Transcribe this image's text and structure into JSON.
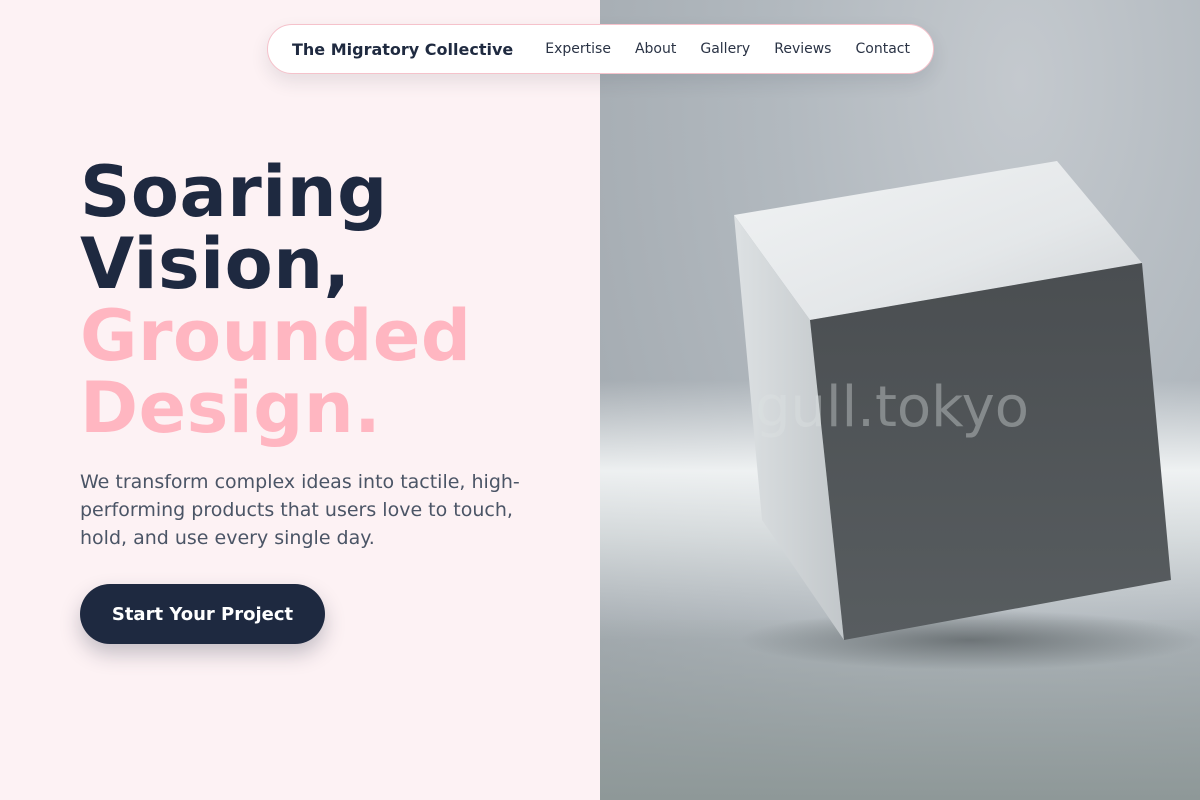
{
  "nav": {
    "brand": "The Migratory Collective",
    "links": [
      "Expertise",
      "About",
      "Gallery",
      "Reviews",
      "Contact"
    ]
  },
  "hero": {
    "headline_dark": [
      "Soaring",
      "Vision,"
    ],
    "headline_pink": [
      "Grounded",
      "Design."
    ],
    "subtext": "We transform complex ideas into tactile, high-performing products that users love to touch, hold, and use every single day.",
    "cta_label": "Start Your Project"
  },
  "image": {
    "subject": "gray cube on a softly lit surface",
    "watermark": "gull.tokyo"
  },
  "colors": {
    "navy": "#1e2940",
    "pink": "#ffb6c1",
    "background": "#fdf2f4",
    "body_text": "#4b5566"
  }
}
